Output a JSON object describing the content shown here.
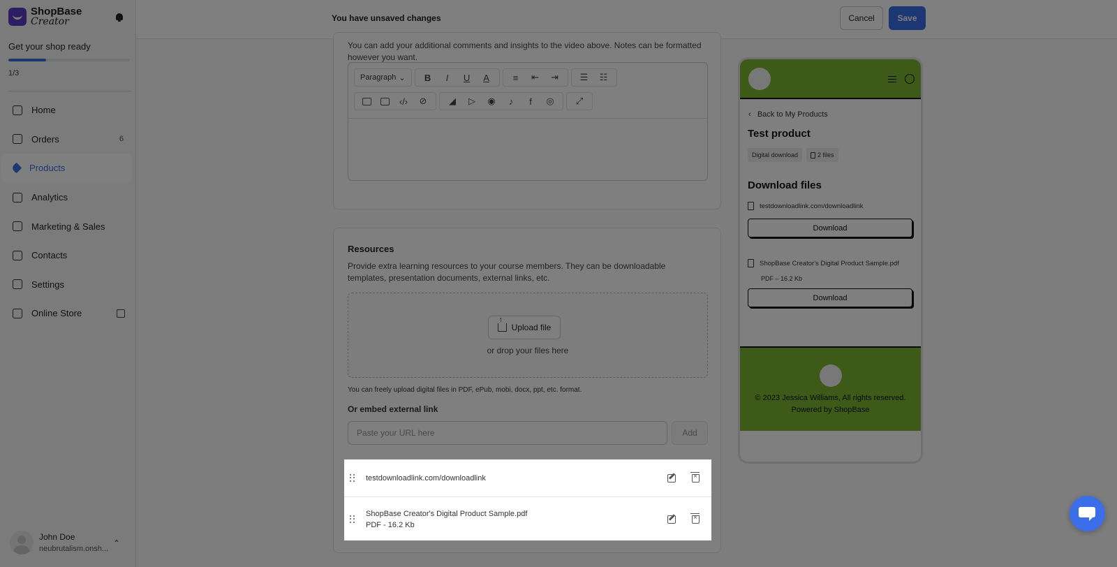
{
  "sidebar": {
    "logo_line1": "ShopBase",
    "logo_line2": "Creator",
    "shop_ready": "Get your shop ready",
    "progress_fraction": 0.31,
    "step": "1/3",
    "items": [
      {
        "label": "Home",
        "icon": "home-icon"
      },
      {
        "label": "Orders",
        "icon": "orders-icon",
        "badge": "6"
      },
      {
        "label": "Products",
        "icon": "tag-icon",
        "active": true
      },
      {
        "label": "Analytics",
        "icon": "analytics-icon"
      },
      {
        "label": "Marketing & Sales",
        "icon": "marketing-icon"
      },
      {
        "label": "Contacts",
        "icon": "contacts-icon"
      },
      {
        "label": "Settings",
        "icon": "gear-icon"
      },
      {
        "label": "Online Store",
        "icon": "store-icon"
      }
    ],
    "user": {
      "name": "John Doe",
      "store": "neubrutalism.onsh..."
    }
  },
  "topbar": {
    "status": "You have unsaved changes",
    "cancel_label": "Cancel",
    "save_label": "Save",
    "accent_color": "#3b6ee8"
  },
  "notes": {
    "text": "You can add your additional comments and insights to the video above. Notes can be formatted however you want.",
    "paragraph_select": "Paragraph"
  },
  "resources": {
    "title": "Resources",
    "description": "Provide extra learning resources to your course members. They can be downloadable templates, presentation documents, external links, etc.",
    "upload_label": "Upload file",
    "drop_text": "or drop your files here",
    "upload_note": "You can freely upload digital files in PDF, ePub, mobi, docx, ppt, etc. format.",
    "embed_label": "Or embed external link",
    "url_placeholder": "Paste your URL here",
    "add_label": "Add",
    "items": [
      {
        "name": "testdownloadlink.com/downloadlink"
      },
      {
        "name": "ShopBase Creator's Digital Product Sample.pdf",
        "meta": "PDF - 16.2 Kb"
      }
    ]
  },
  "preview": {
    "back_link": "Back to My Products",
    "product_title": "Test product",
    "tags": [
      "Digital download",
      "2 files"
    ],
    "download_title": "Download files",
    "files": [
      {
        "name": "testdownloadlink.com/downloadlink"
      },
      {
        "name": "ShopBase Creator's Digital Product Sample.pdf",
        "meta": "PDF – 16.2 Kb"
      }
    ],
    "download_label": "Download",
    "copyright": "© 2023 Jessica Williams, All rights reserved.",
    "powered_by": "Powered by ShopBase",
    "theme_color": "#7ab530"
  }
}
